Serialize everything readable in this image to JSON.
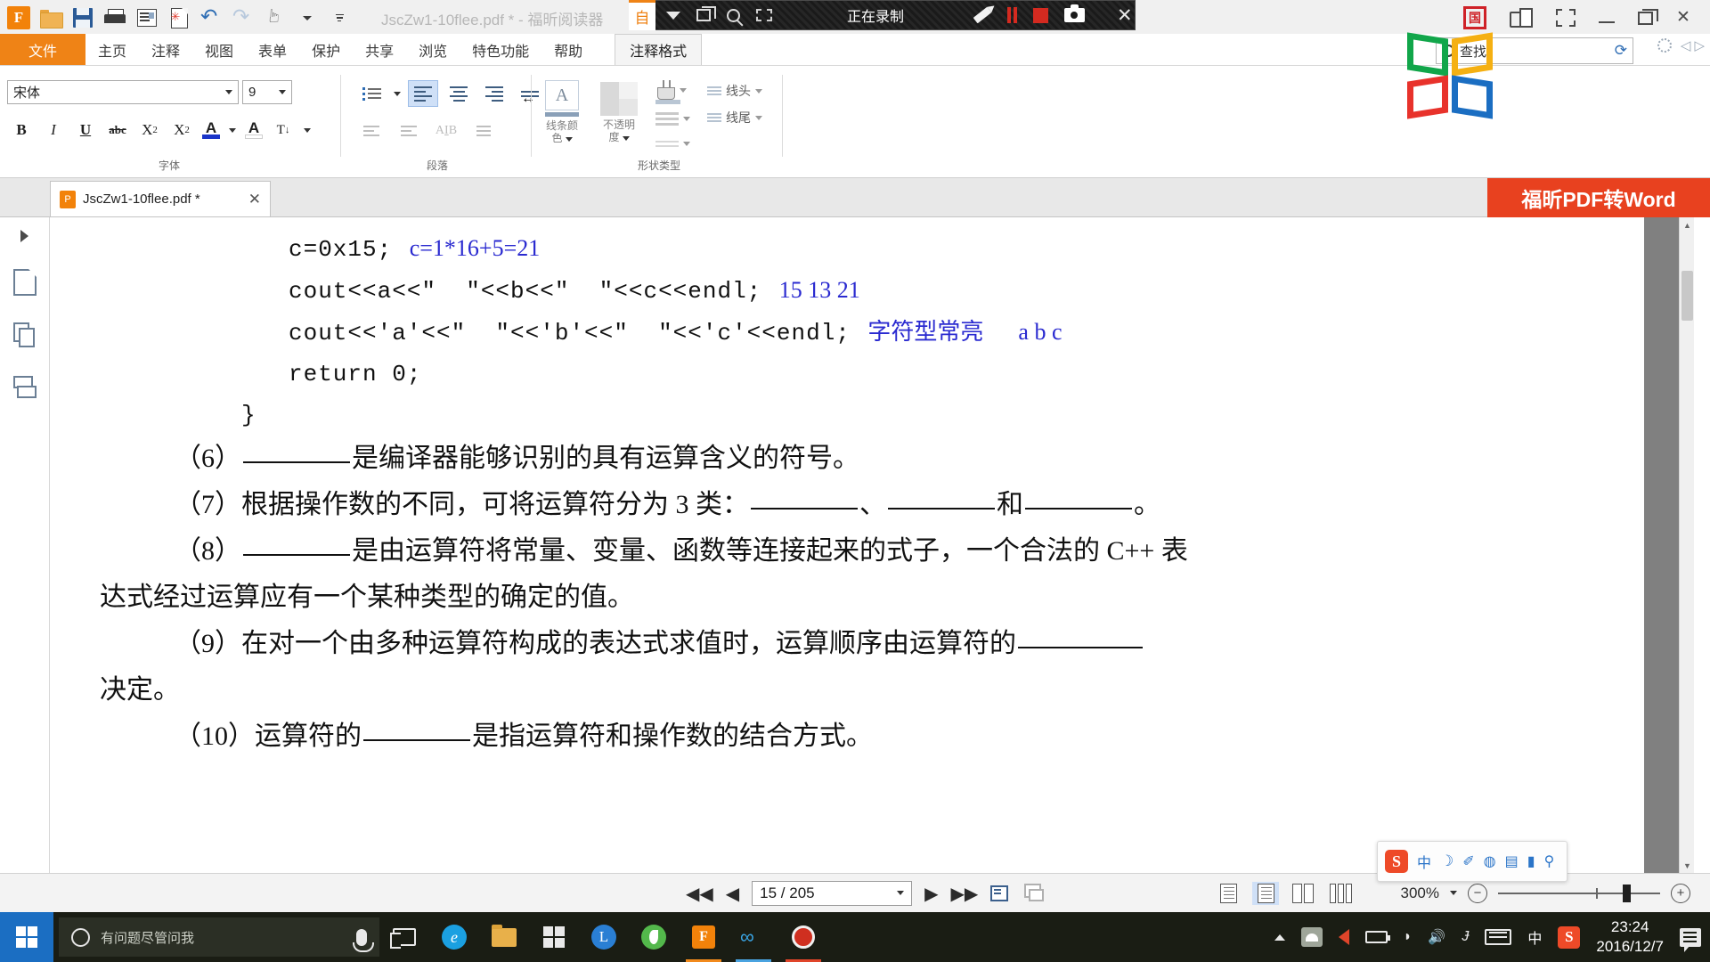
{
  "window": {
    "title": "JscZw1-10flee.pdf * - 福昕阅读器",
    "quick_access": [
      {
        "name": "foxit-logo-icon",
        "label": "F"
      },
      {
        "name": "open-folder-icon",
        "label": ""
      },
      {
        "name": "save-icon",
        "label": ""
      },
      {
        "name": "print-icon",
        "label": ""
      },
      {
        "name": "page-layout-icon",
        "label": ""
      },
      {
        "name": "new-document-icon",
        "label": ""
      },
      {
        "name": "undo-icon",
        "label": "↶"
      },
      {
        "name": "redo-icon",
        "label": "↷"
      },
      {
        "name": "hand-tool-icon",
        "label": ""
      }
    ],
    "right_icons": [
      {
        "name": "chinese-stamp-icon",
        "label": "国"
      },
      {
        "name": "ribbon-toggle-icon",
        "label": ""
      },
      {
        "name": "fullscreen-icon",
        "label": ""
      },
      {
        "name": "minimize-icon",
        "label": ""
      },
      {
        "name": "restore-icon",
        "label": ""
      },
      {
        "name": "close-icon",
        "label": "✕"
      }
    ]
  },
  "recorder": {
    "status_label": "正在录制",
    "auto_label": "自",
    "buttons": [
      {
        "name": "dropdown-icon",
        "label": ""
      },
      {
        "name": "window-select-icon",
        "label": ""
      },
      {
        "name": "magnifier-icon",
        "label": ""
      },
      {
        "name": "region-select-icon",
        "label": ""
      },
      {
        "name": "pencil-icon",
        "label": ""
      },
      {
        "name": "pause-icon",
        "label": ""
      },
      {
        "name": "stop-icon",
        "label": ""
      },
      {
        "name": "camera-icon",
        "label": ""
      },
      {
        "name": "close-icon",
        "label": "✕"
      }
    ]
  },
  "menu": {
    "file_label": "文件",
    "items": [
      "主页",
      "注释",
      "视图",
      "表单",
      "保护",
      "共享",
      "浏览",
      "特色功能",
      "帮助"
    ],
    "context_tab": "注释格式"
  },
  "find": {
    "placeholder": "查找",
    "label": "查找"
  },
  "ribbon": {
    "font": {
      "group_label": "字体",
      "font_name": "宋体",
      "font_size": "9",
      "buttons": [
        {
          "name": "bold-button",
          "label": "B"
        },
        {
          "name": "italic-button",
          "label": "I"
        },
        {
          "name": "underline-button",
          "label": "U"
        },
        {
          "name": "strikethrough-button",
          "label": "abc"
        },
        {
          "name": "superscript-button",
          "label": "X"
        },
        {
          "name": "subscript-button",
          "label": "X"
        },
        {
          "name": "font-color-button",
          "label": "A"
        },
        {
          "name": "text-highlight-button",
          "label": "A"
        }
      ]
    },
    "paragraph": {
      "group_label": "段落",
      "buttons": [
        {
          "name": "bullet-list-button",
          "label": ""
        },
        {
          "name": "align-left-button",
          "label": ""
        },
        {
          "name": "align-center-button",
          "label": ""
        },
        {
          "name": "align-right-button",
          "label": ""
        },
        {
          "name": "justify-button",
          "label": ""
        },
        {
          "name": "decrease-indent-button",
          "label": ""
        },
        {
          "name": "increase-indent-button",
          "label": ""
        },
        {
          "name": "text-direction-button",
          "label": ""
        },
        {
          "name": "line-spacing-button",
          "label": ""
        }
      ]
    },
    "shape": {
      "group_label": "形状类型",
      "line_color_label": "线条颜色",
      "line_color_line1": "线条颜",
      "line_color_line2": "色",
      "opacity_label": "不透明度",
      "opacity_line1": "不透明",
      "opacity_line2": "度",
      "line_head_label": "线头",
      "line_tail_label": "线尾"
    }
  },
  "tabs": {
    "document_tab": "JscZw1-10flee.pdf *",
    "close_label": "✕",
    "word_banner": "福昕PDF转Word"
  },
  "left_rail": [
    {
      "name": "expand-panel-icon",
      "label": ""
    },
    {
      "name": "page-thumbnail-icon",
      "label": ""
    },
    {
      "name": "layers-icon",
      "label": ""
    },
    {
      "name": "comments-icon",
      "label": ""
    }
  ],
  "document": {
    "code_lines": [
      {
        "code": "c=0x15;",
        "ann": "c=1*16+5=21",
        "ann_cn": false
      },
      {
        "code": "cout<<a<<\"  \"<<b<<\"  \"<<c<<endl;",
        "ann": "15 13 21",
        "ann_cn": false
      },
      {
        "code": "cout<<'a'<<\"  \"<<'b'<<\"  \"<<'c'<<endl;",
        "ann": "字符型常亮      a b c",
        "ann_cn": true
      },
      {
        "code": "return 0;",
        "ann": "",
        "ann_cn": false
      }
    ],
    "closing_brace": "}",
    "paragraphs": [
      {
        "number": "（6）",
        "parts": [
          "BLANK",
          "是编译器能够识别的具有运算含义的符号。"
        ]
      },
      {
        "number": "（7）",
        "parts": [
          "根据操作数的不同，可将运算符分为 3 类：",
          "BLANK",
          "、",
          "BLANK",
          "和",
          "BLANK",
          "。"
        ]
      },
      {
        "number": "（8）",
        "parts": [
          "BLANK",
          "是由运算符将常量、变量、函数等连接起来的式子，一个合法的 C++ 表"
        ],
        "continuation": "达式经过运算应有一个某种类型的确定的值。"
      },
      {
        "number": "（9）",
        "parts": [
          "在对一个由多种运算符构成的表达式求值时，运算顺序由运算符的",
          "BLANK"
        ],
        "continuation": "决定。"
      },
      {
        "number": "（10）",
        "parts": [
          "运算符的",
          "BLANK",
          "是指运算符和操作数的结合方式。"
        ]
      }
    ]
  },
  "status_bar": {
    "page_value": "15 / 205",
    "zoom_value": "300%",
    "nav": [
      {
        "name": "first-page-button",
        "label": "◀◀"
      },
      {
        "name": "previous-page-button",
        "label": "◀"
      },
      {
        "name": "next-page-button",
        "label": "▶"
      },
      {
        "name": "last-page-button",
        "label": "▶▶"
      }
    ],
    "view_modes": [
      {
        "name": "single-page-view-button",
        "label": ""
      },
      {
        "name": "continuous-view-button",
        "label": ""
      },
      {
        "name": "two-page-view-button",
        "label": ""
      },
      {
        "name": "two-page-continuous-view-button",
        "label": ""
      }
    ],
    "zoom_out_label": "−",
    "zoom_in_label": "+"
  },
  "sogou_toolbar": {
    "logo": "S",
    "mode_label": "中",
    "icons": [
      {
        "name": "moon-icon",
        "label": "☽"
      },
      {
        "name": "pin-icon",
        "label": "✎"
      },
      {
        "name": "microphone-icon",
        "label": "🎤"
      },
      {
        "name": "keyboard-icon",
        "label": "⌨"
      },
      {
        "name": "briefcase-icon",
        "label": "💼"
      },
      {
        "name": "toolbox-icon",
        "label": "🔧"
      }
    ]
  },
  "taskbar": {
    "search_placeholder": "有问题尽管问我",
    "pinned": [
      {
        "name": "taskview-icon",
        "label": ""
      },
      {
        "name": "edge-icon",
        "label": "e"
      },
      {
        "name": "file-explorer-icon",
        "label": ""
      },
      {
        "name": "store-icon",
        "label": ""
      },
      {
        "name": "app-l-icon",
        "label": "L"
      },
      {
        "name": "leaf-app-icon",
        "label": ""
      },
      {
        "name": "foxit-reader-icon",
        "label": "F"
      },
      {
        "name": "link-app-icon",
        "label": "∞"
      },
      {
        "name": "recorder-app-icon",
        "label": ""
      }
    ],
    "tray": {
      "ime_label": "中",
      "sogou_label": "S",
      "time": "23:24",
      "date": "2016/12/7"
    }
  },
  "colors": {
    "accent_orange": "#ef8316",
    "word_red": "#e8411f",
    "annotation_blue": "#2a2ad0",
    "taskbar_bg": "#1a1d14",
    "start_blue": "#1b6ec2"
  }
}
